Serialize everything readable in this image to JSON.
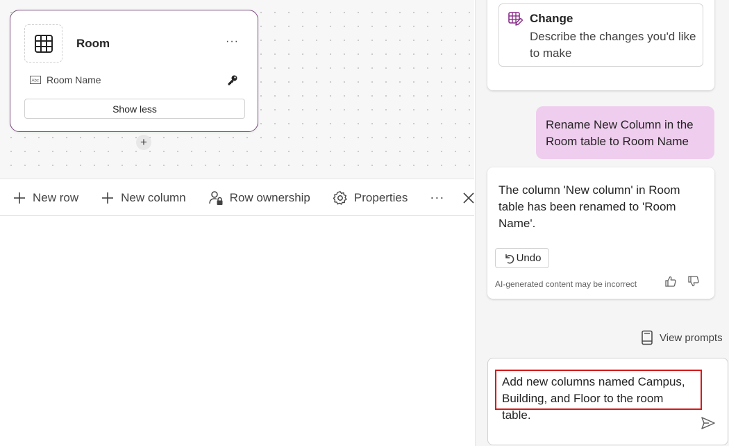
{
  "canvas": {
    "table_card": {
      "title": "Room",
      "more_label": "···",
      "column_label": "Room Name",
      "show_less_label": "Show less",
      "add_label": "+",
      "icons": [
        "table-grid-icon",
        "text-field-icon",
        "key-icon"
      ]
    }
  },
  "command_bar": {
    "new_row": "New row",
    "new_column": "New column",
    "row_ownership": "Row ownership",
    "properties": "Properties",
    "more": "···",
    "icons": [
      "plus-icon",
      "person-lock-icon",
      "gear-icon",
      "close-icon"
    ]
  },
  "copilot": {
    "suggestion": {
      "title": "Change",
      "description": "Describe the changes you'd like to make",
      "icon": "table-edit-icon"
    },
    "user_message": "Rename New Column in the Room table to Room Name",
    "ai_message": "The column 'New column' in Room table has been renamed to 'Room Name'.",
    "undo_label": "Undo",
    "disclaimer": "AI-generated content may be incorrect",
    "view_prompts_label": "View prompts",
    "input_text": "Add new columns named Campus, Building, and Floor to the room table.",
    "icons": [
      "undo-icon",
      "thumbs-up-icon",
      "thumbs-down-icon",
      "book-icon",
      "send-icon"
    ]
  },
  "colors": {
    "card_border": "#7b4a7e",
    "user_bubble": "#efcdee",
    "highlight_border": "#d21a1a",
    "icon_accent": "#8b2f8c"
  }
}
